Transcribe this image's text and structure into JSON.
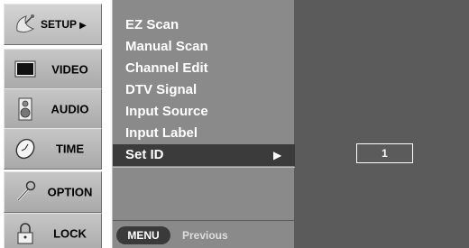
{
  "sidebar": {
    "items": [
      {
        "label": "SETUP",
        "arrow": "▶",
        "icon": "satellite-dish-icon",
        "active": true
      },
      {
        "label": "VIDEO",
        "icon": "monitor-icon"
      },
      {
        "label": "AUDIO",
        "icon": "speaker-icon"
      },
      {
        "label": "TIME",
        "icon": "clock-icon"
      },
      {
        "label": "OPTION",
        "icon": "wrench-icon"
      },
      {
        "label": "LOCK",
        "icon": "padlock-icon"
      }
    ]
  },
  "submenu": {
    "items": [
      "EZ Scan",
      "Manual Scan",
      "Channel Edit",
      "DTV Signal",
      "Input Source",
      "Input Label",
      "Set ID"
    ],
    "selected_index": 6,
    "selected_arrow": "▶"
  },
  "footer": {
    "menu_label": "MENU",
    "previous_label": "Previous"
  },
  "set_id_panel": {
    "value": "1"
  },
  "colors": {
    "submenu_bg": "#8a8a8a",
    "selected_bg": "#3b3b3b",
    "panel_bg": "#5b5b5b",
    "sidebar_bg": "#b5b5b5"
  }
}
